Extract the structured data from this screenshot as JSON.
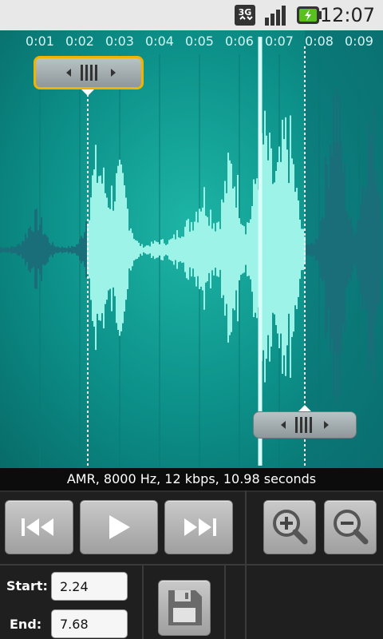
{
  "status": {
    "network_label": "3G",
    "time": "12:07",
    "icons": [
      "network-3g-icon",
      "signal-strength-icon",
      "battery-charging-icon"
    ]
  },
  "timeline": {
    "ticks": [
      "0:01",
      "0:02",
      "0:03",
      "0:04",
      "0:05",
      "0:06",
      "0:07",
      "0:08",
      "0:09"
    ]
  },
  "info": {
    "text": "AMR, 8000 Hz, 12 kbps, 10.98 seconds"
  },
  "controls": {
    "rewind_icon": "rewind-icon",
    "play_icon": "play-icon",
    "fast_forward_icon": "fast-forward-icon",
    "zoom_in_icon": "zoom-in-icon",
    "zoom_out_icon": "zoom-out-icon",
    "save_icon": "save-icon"
  },
  "selection": {
    "start_label": "Start:",
    "start_value": "2.24",
    "end_label": "End:",
    "end_value": "7.68"
  },
  "colors": {
    "waveform_bg": "#0c8f88",
    "waveform_selected": "#9ef3e8",
    "waveform_unselected": "#1a6e7a",
    "start_handle_border": "#f0b400"
  }
}
